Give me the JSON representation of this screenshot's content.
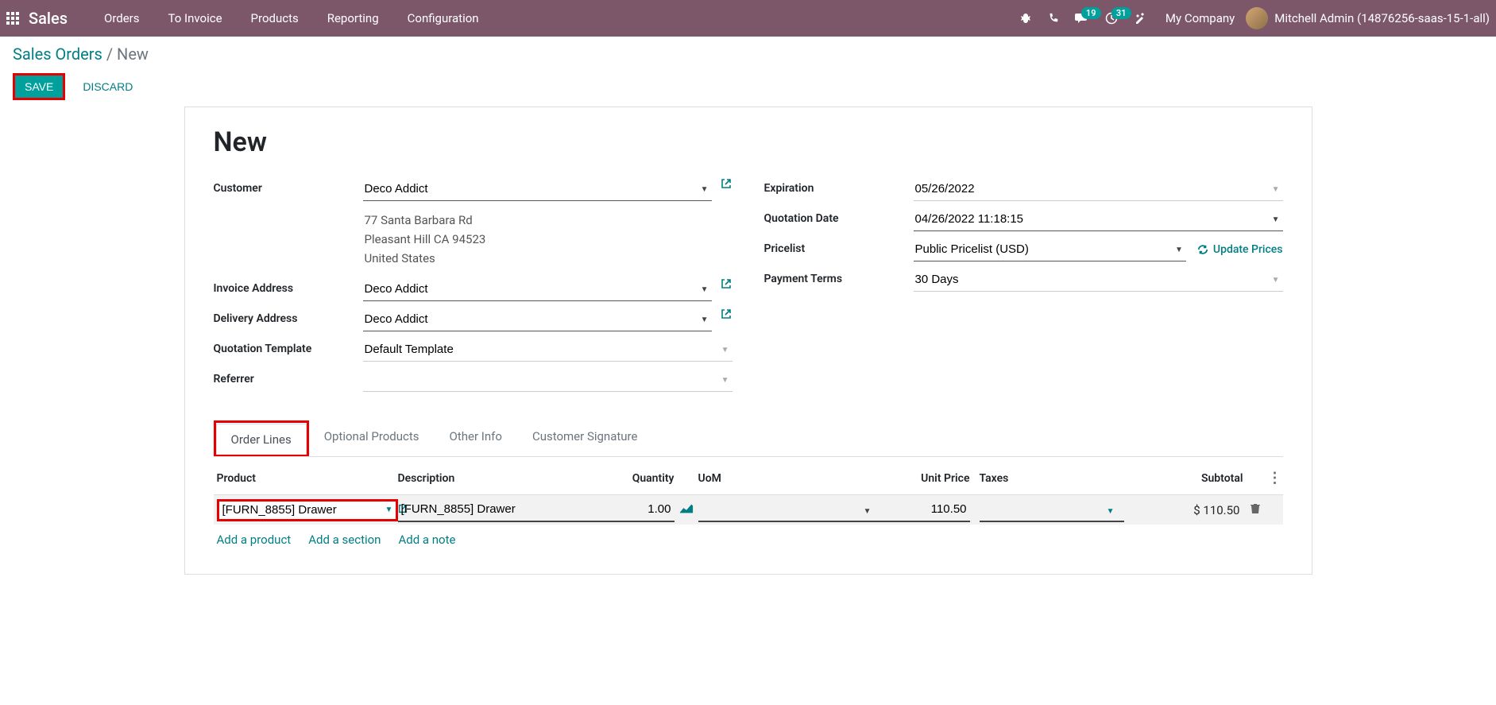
{
  "navbar": {
    "brand": "Sales",
    "menu": [
      "Orders",
      "To Invoice",
      "Products",
      "Reporting",
      "Configuration"
    ],
    "msg_count": "19",
    "activity_count": "31",
    "company": "My Company",
    "user": "Mitchell Admin (14876256-saas-15-1-all)"
  },
  "breadcrumb": {
    "root": "Sales Orders",
    "sep": "/",
    "current": "New"
  },
  "actions": {
    "save": "SAVE",
    "discard": "DISCARD"
  },
  "title": "New",
  "form": {
    "customer_label": "Customer",
    "customer_value": "Deco Addict",
    "address_line1": "77 Santa Barbara Rd",
    "address_line2": "Pleasant Hill CA 94523",
    "address_line3": "United States",
    "invoice_label": "Invoice Address",
    "invoice_value": "Deco Addict",
    "delivery_label": "Delivery Address",
    "delivery_value": "Deco Addict",
    "template_label": "Quotation Template",
    "template_value": "Default Template",
    "referrer_label": "Referrer",
    "referrer_value": "",
    "expiration_label": "Expiration",
    "expiration_value": "05/26/2022",
    "quote_date_label": "Quotation Date",
    "quote_date_value": "04/26/2022 11:18:15",
    "pricelist_label": "Pricelist",
    "pricelist_value": "Public Pricelist (USD)",
    "update_prices": "Update Prices",
    "terms_label": "Payment Terms",
    "terms_value": "30 Days"
  },
  "tabs": [
    "Order Lines",
    "Optional Products",
    "Other Info",
    "Customer Signature"
  ],
  "columns": {
    "product": "Product",
    "desc": "Description",
    "qty": "Quantity",
    "uom": "UoM",
    "price": "Unit Price",
    "taxes": "Taxes",
    "subtotal": "Subtotal"
  },
  "line": {
    "product": "[FURN_8855] Drawer",
    "desc": "[FURN_8855] Drawer",
    "qty": "1.00",
    "uom": "",
    "price": "110.50",
    "taxes": "",
    "subtotal": "$ 110.50"
  },
  "add": {
    "product": "Add a product",
    "section": "Add a section",
    "note": "Add a note"
  }
}
